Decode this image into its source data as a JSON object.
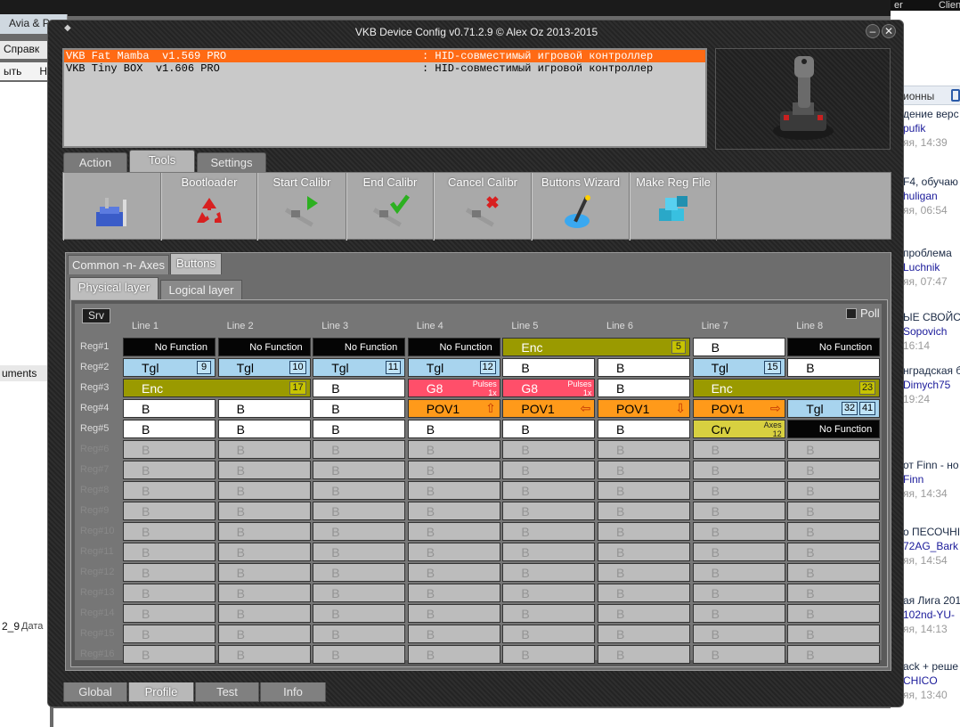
{
  "background": {
    "top_tab": "Avia & P",
    "menu": "Справк",
    "menu2": "ыть",
    "menu2b": "Н",
    "left_docs": "uments",
    "left_version": "2_9",
    "left_version_label": "Дата",
    "top_right_a": "er",
    "top_right_b": "Clien",
    "right_header": "ионны",
    "feed": [
      {
        "a": "дение верс",
        "b": "pufik",
        "c": "яя, 14:39"
      },
      {
        "a": "F4, обучаю",
        "b": "huligan",
        "c": "яя, 06:54"
      },
      {
        "a": "проблема",
        "b": "Luchnik",
        "c": "яя, 07:47"
      },
      {
        "a": "ЫЕ СВОЙС",
        "b": "Sopovich",
        "c": "16:14"
      },
      {
        "a": "нградская б",
        "b": "Dimych75",
        "c": "19:24"
      },
      {
        "a": "от Finn - но",
        "b": "Finn",
        "c": "яя, 14:34"
      },
      {
        "a": "о ПЕСОЧНІ",
        "b": "72AG_Bark",
        "c": "яя, 14:54"
      },
      {
        "a": "ая Лига 201",
        "b": "102nd-YU-",
        "c": "яя, 14:13"
      },
      {
        "a": "ack + реше",
        "b": "CHICO",
        "c": "яя, 13:40"
      }
    ]
  },
  "window": {
    "title": "VKB Device Config v0.71.2.9 © Alex Oz 2013-2015",
    "min": "–",
    "close": "✕"
  },
  "devices": [
    {
      "name": "VKB Fat Mamba  v1.569 PRO",
      "desc": ": HID-совместимый игровой контроллер",
      "selected": true
    },
    {
      "name": "VKB Tiny BOX  v1.606 PRO",
      "desc": ": HID-совместимый игровой контроллер",
      "selected": false
    }
  ],
  "top_tabs": [
    {
      "label": "Action"
    },
    {
      "label": "Tools"
    },
    {
      "label": "Settings"
    }
  ],
  "tools": [
    {
      "label": "",
      "icon": "toolbox-icon"
    },
    {
      "label": "Bootloader",
      "icon": "recycle-icon"
    },
    {
      "label": "Start Calibr",
      "icon": "caliper-play-icon"
    },
    {
      "label": "End Calibr",
      "icon": "caliper-check-icon"
    },
    {
      "label": "Cancel Calibr",
      "icon": "caliper-cancel-icon"
    },
    {
      "label": "Buttons Wizard",
      "icon": "magic-wand-icon"
    },
    {
      "label": "Make Reg File",
      "icon": "registry-cubes-icon"
    }
  ],
  "sub_tabs": [
    {
      "label": "Common -n- Axes"
    },
    {
      "label": "Buttons"
    }
  ],
  "layer_tabs": [
    {
      "label": "Physical layer"
    },
    {
      "label": "Logical layer"
    }
  ],
  "srv": "Srv",
  "poll": "Poll",
  "lines": [
    "Line 1",
    "Line 2",
    "Line 3",
    "Line 4",
    "Line 5",
    "Line 6",
    "Line 7",
    "Line 8"
  ],
  "regs": [
    "Reg#1",
    "Reg#2",
    "Reg#3",
    "Reg#4",
    "Reg#5",
    "Reg#6",
    "Reg#7",
    "Reg#8",
    "Reg#9",
    "Reg#10",
    "Reg#11",
    "Reg#12",
    "Reg#13",
    "Reg#14",
    "Reg#15",
    "Reg#16"
  ],
  "active_regs": 5,
  "grid": [
    [
      {
        "t": "nf",
        "l": "No Function"
      },
      {
        "t": "nf",
        "l": "No Function"
      },
      {
        "t": "nf",
        "l": "No Function"
      },
      {
        "t": "nf",
        "l": "No Function"
      },
      {
        "t": "enc",
        "l": "Enc",
        "n": "5",
        "span": 2
      },
      {
        "t": "b",
        "l": "B"
      },
      {
        "t": "nf",
        "l": "No Function"
      }
    ],
    [
      {
        "t": "tgl",
        "l": "Tgl",
        "n": "9"
      },
      {
        "t": "tgl",
        "l": "Tgl",
        "n": "10"
      },
      {
        "t": "tgl",
        "l": "Tgl",
        "n": "11"
      },
      {
        "t": "tgl",
        "l": "Tgl",
        "n": "12"
      },
      {
        "t": "b",
        "l": "B"
      },
      {
        "t": "b",
        "l": "B"
      },
      {
        "t": "tgl",
        "l": "Tgl",
        "n": "15"
      },
      {
        "t": "b",
        "l": "B"
      }
    ],
    [
      {
        "t": "enc",
        "l": "Enc",
        "n": "17",
        "span": 2
      },
      {
        "t": "b",
        "l": "B"
      },
      {
        "t": "g8",
        "l": "G8",
        "p1": "Pulses",
        "p2": "1x"
      },
      {
        "t": "g8",
        "l": "G8",
        "p1": "Pulses",
        "p2": "1x"
      },
      {
        "t": "b",
        "l": "B"
      },
      {
        "t": "enc",
        "l": "Enc",
        "n": "23",
        "span": 2
      }
    ],
    [
      {
        "t": "b",
        "l": "B"
      },
      {
        "t": "b",
        "l": "B"
      },
      {
        "t": "b",
        "l": "B"
      },
      {
        "t": "pov",
        "l": "POV1",
        "a": "⇧"
      },
      {
        "t": "pov",
        "l": "POV1",
        "a": "⇦"
      },
      {
        "t": "pov",
        "l": "POV1",
        "a": "⇩"
      },
      {
        "t": "pov",
        "l": "POV1",
        "a": "⇨"
      },
      {
        "t": "tgl",
        "l": "Tgl",
        "n": "32",
        "n2": "41"
      }
    ],
    [
      {
        "t": "b",
        "l": "B"
      },
      {
        "t": "b",
        "l": "B"
      },
      {
        "t": "b",
        "l": "B"
      },
      {
        "t": "b",
        "l": "B"
      },
      {
        "t": "b",
        "l": "B"
      },
      {
        "t": "b",
        "l": "B"
      },
      {
        "t": "crv",
        "l": "Crv",
        "p1": "Axes",
        "p2": "12"
      },
      {
        "t": "nf",
        "l": "No Function"
      }
    ]
  ],
  "disabled_label": "B",
  "bottom_tabs": [
    {
      "label": "Global"
    },
    {
      "label": "Profile"
    },
    {
      "label": "Test"
    },
    {
      "label": "Info"
    }
  ]
}
